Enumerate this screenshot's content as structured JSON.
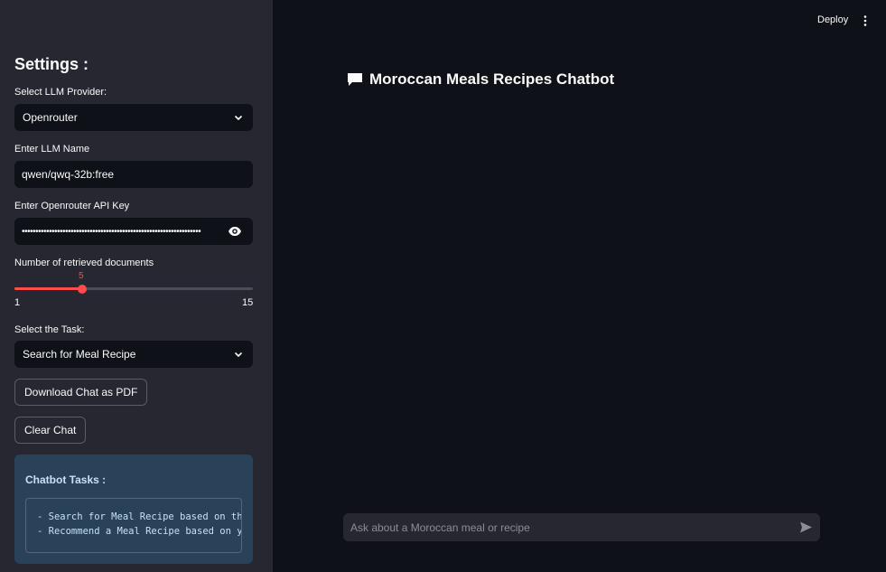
{
  "header": {
    "deploy_label": "Deploy"
  },
  "sidebar": {
    "title": "Settings :",
    "provider": {
      "label": "Select LLM Provider:",
      "value": "Openrouter"
    },
    "llm_name": {
      "label": "Enter LLM Name",
      "value": "qwen/qwq-32b:free"
    },
    "api_key": {
      "label": "Enter Openrouter API Key",
      "masked_value": "••••••••••••••••••••••••••••••••••••••••••••••••••••••••••••••••••"
    },
    "docs_slider": {
      "label": "Number of retrieved documents",
      "value": "5",
      "min": "1",
      "max": "15",
      "fraction": 0.2857
    },
    "task": {
      "label": "Select the Task:",
      "value": "Search for Meal Recipe"
    },
    "download_button": "Download Chat as PDF",
    "clear_button": "Clear Chat",
    "info": {
      "title": "Chatbot Tasks :",
      "lines": [
        "- Search for Meal Recipe based on the user query",
        "- Recommend a Meal Recipe based on your available ingredients"
      ]
    }
  },
  "main": {
    "title": "Moroccan Meals Recipes Chatbot",
    "chat_placeholder": "Ask about a Moroccan meal or recipe"
  },
  "colors": {
    "accent": "#ff4b4b",
    "sidebar_bg": "#262730",
    "main_bg": "#0e1117",
    "info_bg": "#2a415a"
  }
}
